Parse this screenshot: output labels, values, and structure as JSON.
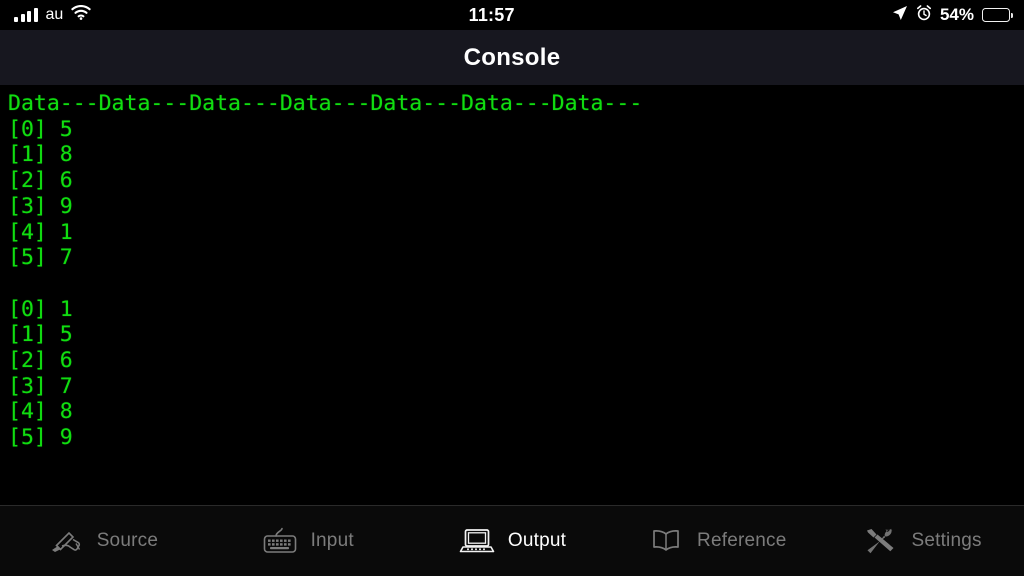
{
  "status_bar": {
    "carrier": "au",
    "time": "11:57",
    "battery_percent": "54%",
    "battery_level": 54,
    "icons": [
      "signal-bars-icon",
      "wifi-icon",
      "location-arrow-icon",
      "alarm-clock-icon",
      "battery-icon"
    ]
  },
  "nav": {
    "title": "Console"
  },
  "console": {
    "header_line": "Data---Data---Data---Data---Data---Data---Data---",
    "text_color": "#11dd11",
    "background_color": "#000000",
    "blocks": [
      {
        "rows": [
          {
            "index": "[0]",
            "value": "5"
          },
          {
            "index": "[1]",
            "value": "8"
          },
          {
            "index": "[2]",
            "value": "6"
          },
          {
            "index": "[3]",
            "value": "9"
          },
          {
            "index": "[4]",
            "value": "1"
          },
          {
            "index": "[5]",
            "value": "7"
          }
        ]
      },
      {
        "rows": [
          {
            "index": "[0]",
            "value": "1"
          },
          {
            "index": "[1]",
            "value": "5"
          },
          {
            "index": "[2]",
            "value": "6"
          },
          {
            "index": "[3]",
            "value": "7"
          },
          {
            "index": "[4]",
            "value": "8"
          },
          {
            "index": "[5]",
            "value": "9"
          }
        ]
      }
    ],
    "full_text": "Data---Data---Data---Data---Data---Data---Data---\n[0] 5\n[1] 8\n[2] 6\n[3] 9\n[4] 1\n[5] 7\n\n[0] 1\n[1] 5\n[2] 6\n[3] 7\n[4] 8\n[5] 9"
  },
  "tab_bar": {
    "active_index": 2,
    "items": [
      {
        "label": "Source",
        "icon": "writing-hand-icon",
        "active": false
      },
      {
        "label": "Input",
        "icon": "keyboard-icon",
        "active": false
      },
      {
        "label": "Output",
        "icon": "laptop-computer-icon",
        "active": true
      },
      {
        "label": "Reference",
        "icon": "open-book-icon",
        "active": false
      },
      {
        "label": "Settings",
        "icon": "hammer-wrench-icon",
        "active": false
      }
    ]
  },
  "colors": {
    "terminal_green": "#11dd11",
    "nav_background": "#17171f",
    "tab_active": "#ffffff",
    "tab_inactive": "#7c7c7c"
  }
}
